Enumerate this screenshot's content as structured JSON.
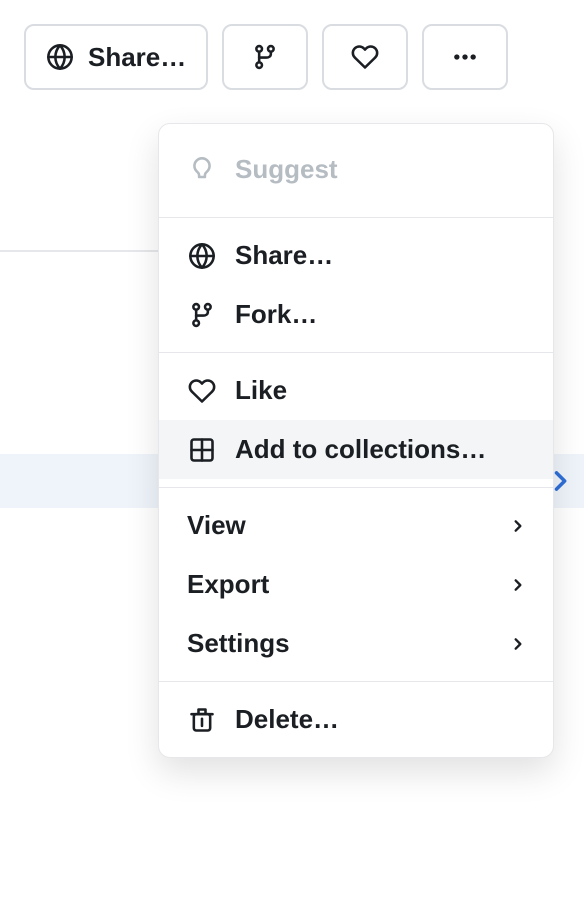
{
  "toolbar": {
    "share_label": "Share…"
  },
  "menu": {
    "suggest": "Suggest",
    "share": "Share…",
    "fork": "Fork…",
    "like": "Like",
    "add_to_collections": "Add to collections…",
    "view": "View",
    "export": "Export",
    "settings": "Settings",
    "delete": "Delete…"
  }
}
